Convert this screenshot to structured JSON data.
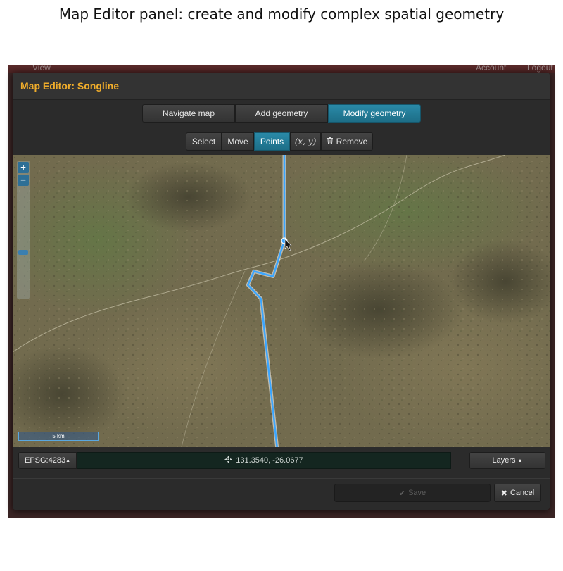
{
  "caption": "Map Editor panel: create and modify complex spatial geometry",
  "background_app": {
    "view_label": "View",
    "account_label": "Account",
    "logout_label": "Logout"
  },
  "dialog": {
    "title": "Map Editor: Songline",
    "title_color": "#f0ad2b",
    "mode_tabs": [
      {
        "label": "Navigate map",
        "active": false
      },
      {
        "label": "Add geometry",
        "active": false
      },
      {
        "label": "Modify geometry",
        "active": true
      }
    ],
    "tools": {
      "select": "Select",
      "move": "Move",
      "points": "Points",
      "xy": "(x, y)",
      "remove": "Remove"
    },
    "active_tool": "Points",
    "accent_color": "#1f7a96"
  },
  "map": {
    "zoom_in": "+",
    "zoom_out": "−",
    "scale_label": "5 km",
    "line_color": "#3ba6ff",
    "line_points": [
      [
        131.354,
        -25.9765
      ],
      [
        131.354,
        -26.0677
      ],
      [
        131.3475,
        -26.0885
      ],
      [
        131.3365,
        -26.0855
      ],
      [
        131.333,
        -26.0935
      ],
      [
        131.3405,
        -26.1015
      ],
      [
        131.358,
        -26.265
      ]
    ]
  },
  "footer": {
    "projection": "EPSG:4283",
    "coordinates": "131.3540, -26.0677",
    "layers": "Layers",
    "save": "Save",
    "cancel": "Cancel"
  }
}
